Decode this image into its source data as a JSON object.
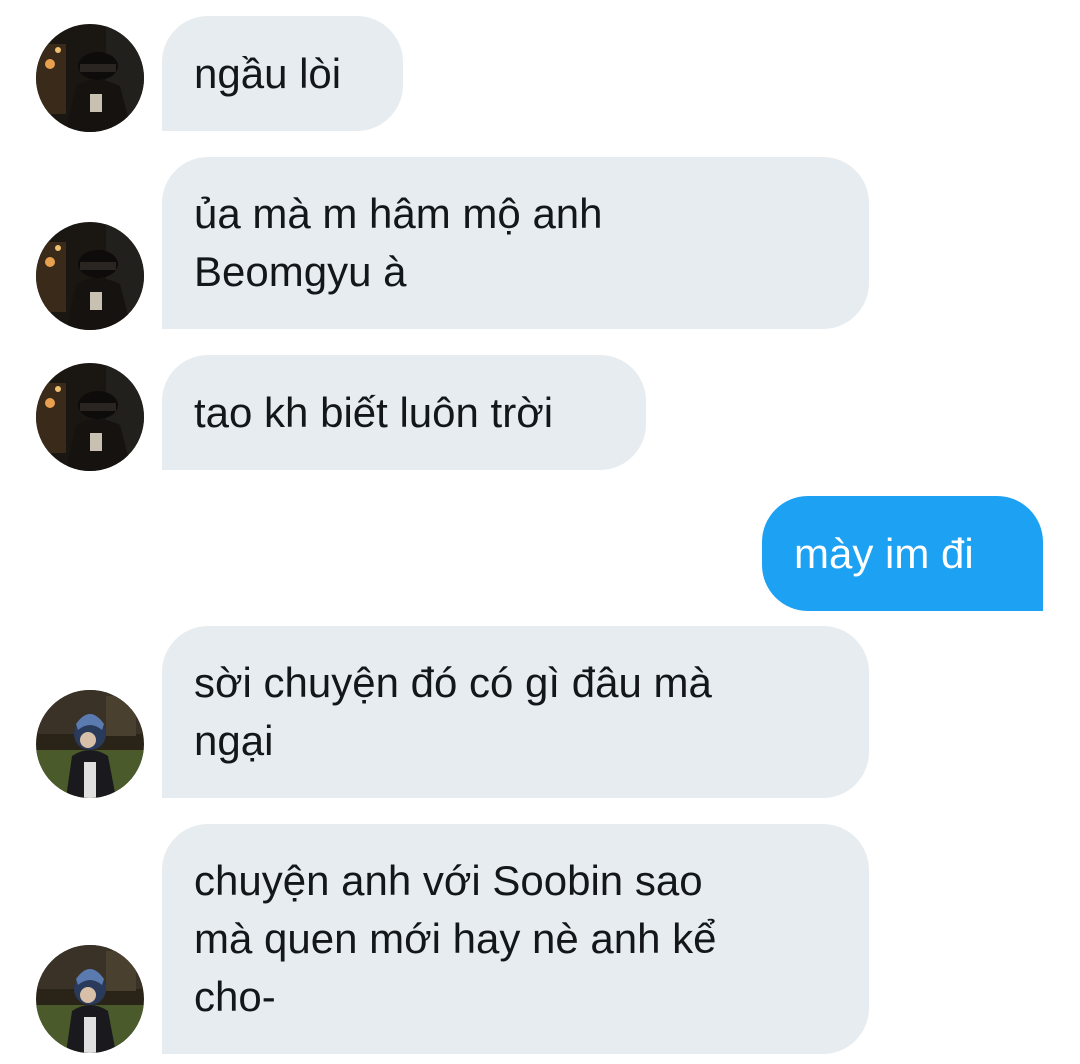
{
  "conversation": {
    "messages": [
      {
        "direction": "incoming",
        "sender": "user-a",
        "text": "ngầu lòi"
      },
      {
        "direction": "incoming",
        "sender": "user-a",
        "text": "ủa mà m hâm mộ anh\nBeomgyu à"
      },
      {
        "direction": "incoming",
        "sender": "user-a",
        "text": "tao kh biết luôn trời"
      },
      {
        "direction": "outgoing",
        "sender": "me",
        "text": "mày im đi"
      },
      {
        "direction": "incoming",
        "sender": "user-b",
        "text": "sời chuyện đó có gì đâu mà\nngại"
      },
      {
        "direction": "incoming",
        "sender": "user-b",
        "text": "chuyện anh với Soobin sao\nmà quen mới hay nè anh kể\ncho-"
      }
    ]
  },
  "colors": {
    "incoming_bubble": "#e6ecf0",
    "outgoing_bubble": "#1da1f2",
    "incoming_text": "#14171a",
    "outgoing_text": "#ffffff"
  },
  "icons": {
    "user_a_avatar": "dark-night-photo-avatar",
    "user_b_avatar": "hooded-figure-photo-avatar"
  }
}
